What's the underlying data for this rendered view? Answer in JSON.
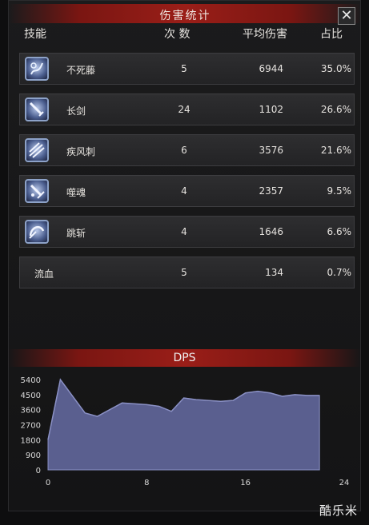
{
  "window": {
    "title": "伤害统计",
    "close_icon": "close-icon"
  },
  "table": {
    "headers": {
      "skill": "技能",
      "count": "次 数",
      "avg": "平均伤害",
      "pct": "占比"
    },
    "rows": [
      {
        "icon": "vine-icon",
        "name": "不死藤",
        "count": "5",
        "avg": "6944",
        "pct": "35.0%"
      },
      {
        "icon": "sword-icon",
        "name": "长剑",
        "count": "24",
        "avg": "1102",
        "pct": "26.6%"
      },
      {
        "icon": "wind-thrust-icon",
        "name": "疾风刺",
        "count": "6",
        "avg": "3576",
        "pct": "21.6%"
      },
      {
        "icon": "soul-bite-icon",
        "name": "噬魂",
        "count": "4",
        "avg": "2357",
        "pct": "9.5%"
      },
      {
        "icon": "leap-slash-icon",
        "name": "跳斩",
        "count": "4",
        "avg": "1646",
        "pct": "6.6%"
      },
      {
        "icon": "",
        "name": "流血",
        "count": "5",
        "avg": "134",
        "pct": "0.7%"
      }
    ]
  },
  "dps": {
    "title": "DPS"
  },
  "chart_data": {
    "type": "area",
    "title": "DPS",
    "xlabel": "",
    "ylabel": "",
    "xlim": [
      0,
      24
    ],
    "ylim": [
      0,
      5400
    ],
    "xticks": [
      "0",
      "8",
      "16",
      "24"
    ],
    "yticks": [
      "0",
      "900",
      "1800",
      "2700",
      "3600",
      "4500",
      "5400"
    ],
    "x": [
      0,
      1,
      3,
      4,
      6,
      8,
      9,
      10,
      11,
      12,
      14,
      15,
      16,
      17,
      18,
      19,
      20,
      21,
      22
    ],
    "y": [
      1800,
      5400,
      3400,
      3200,
      4000,
      3900,
      3800,
      3500,
      4300,
      4200,
      4100,
      4150,
      4600,
      4700,
      4600,
      4400,
      4500,
      4450,
      4450
    ],
    "fill_color": "#5a5f8f",
    "line_color": "#8a90c4",
    "grid": false
  },
  "watermark": "酷乐米"
}
